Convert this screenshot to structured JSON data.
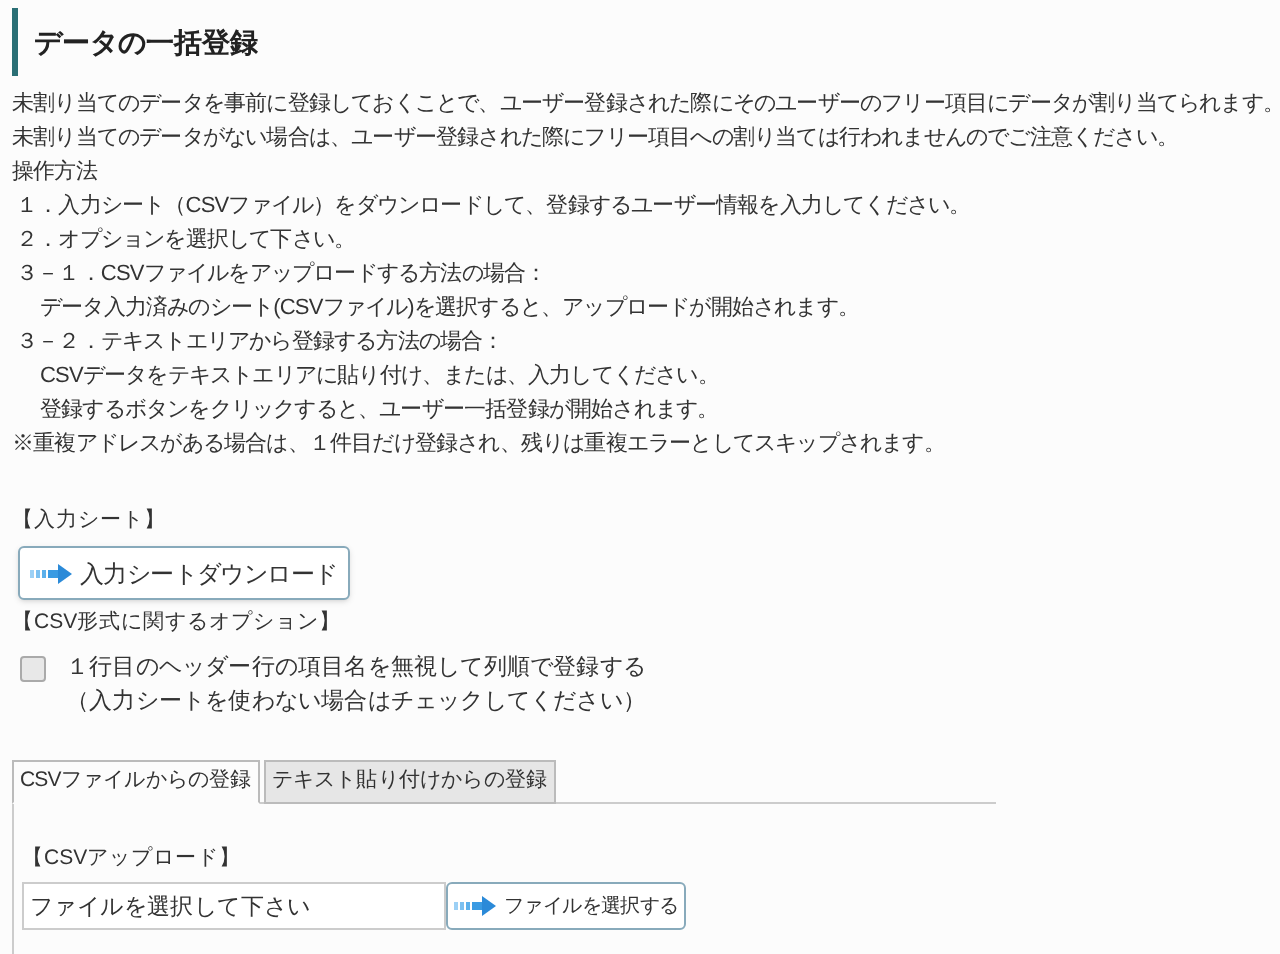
{
  "title": "データの一括登録",
  "description": [
    {
      "kind": "text",
      "text": "未割り当てのデータを事前に登録しておくことで、ユーザー登録された際にそのユーザーのフリー項目にデータが割り当てられます。"
    },
    {
      "kind": "text",
      "text": "未割り当てのデータがない場合は、ユーザー登録された際にフリー項目への割り当ては行われませんのでご注意ください。"
    },
    {
      "kind": "text",
      "text": "操作方法"
    },
    {
      "kind": "step",
      "text": "１．入力シート（CSVファイル）をダウンロードして、登録するユーザー情報を入力してください。"
    },
    {
      "kind": "step",
      "text": "２．オプションを選択して下さい。"
    },
    {
      "kind": "step",
      "text": "３－１．CSVファイルをアップロードする方法の場合："
    },
    {
      "kind": "detail",
      "text": "データ入力済みのシート(CSVファイル)を選択すると、アップロードが開始されます。"
    },
    {
      "kind": "step",
      "text": "３－２．テキストエリアから登録する方法の場合："
    },
    {
      "kind": "detail",
      "text": "CSVデータをテキストエリアに貼り付け、または、入力してください。"
    },
    {
      "kind": "detail",
      "text": "登録するボタンをクリックすると、ユーザー一括登録が開始されます。"
    },
    {
      "kind": "text",
      "text": "※重複アドレスがある場合は、１件目だけ登録され、残りは重複エラーとしてスキップされます。"
    }
  ],
  "input_sheet": {
    "label": "【入力シート】",
    "button": "入力シートダウンロード"
  },
  "options": {
    "label": "【CSV形式に関するオプション】",
    "checkbox": {
      "checked": false,
      "label": "１行目のヘッダー行の項目名を無視して列順で登録する",
      "note": "（入力シートを使わない場合はチェックしてください）"
    }
  },
  "tabs": [
    {
      "label": "CSVファイルからの登録",
      "selected": true
    },
    {
      "label": "テキスト貼り付けからの登録",
      "selected": false
    }
  ],
  "upload": {
    "label": "【CSVアップロード】",
    "file_field": {
      "value": "ファイルを選択して下さい"
    },
    "button": "ファイルを選択する"
  }
}
